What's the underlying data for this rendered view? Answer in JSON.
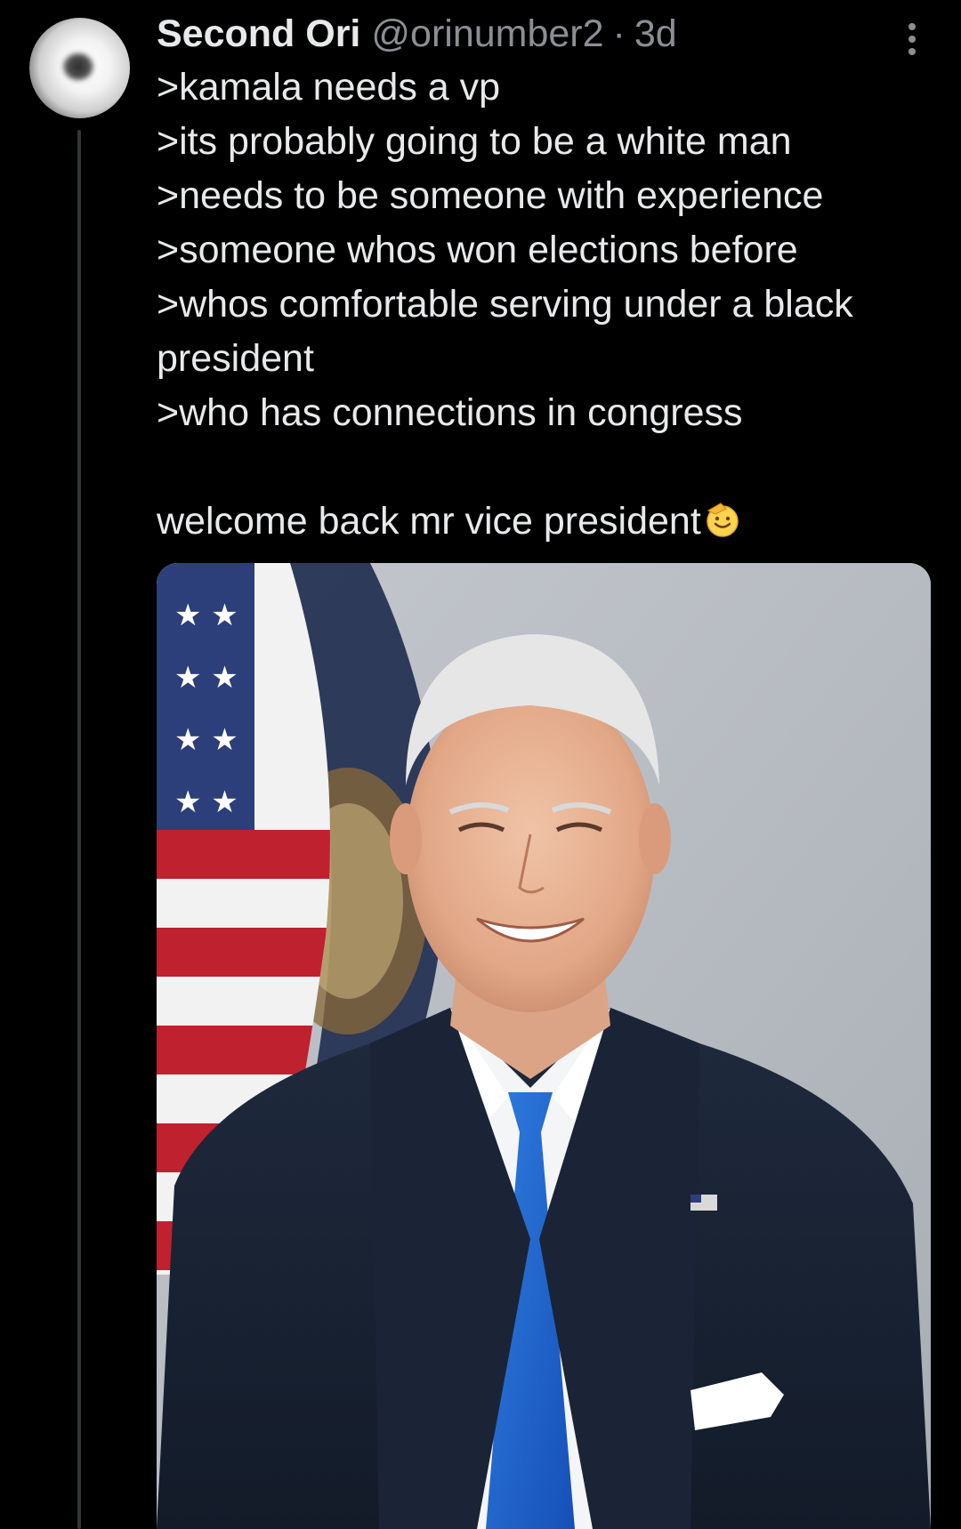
{
  "tweet": {
    "display_name": "Second Ori",
    "handle": "@orinumber2",
    "separator": "·",
    "time": "3d",
    "lines": [
      ">kamala needs a vp",
      ">its probably going to be a white man",
      ">needs to be someone with experience",
      ">someone whos won elections before",
      ">whos comfortable serving under a black president",
      ">who has connections in congress",
      "welcome back mr vice president"
    ],
    "emoji": "saluting-face",
    "media_description": "official portrait photo"
  },
  "colors": {
    "background": "#000000",
    "text": "#e7e9ea",
    "secondary": "#8b8f94",
    "thread_line": "#333639"
  }
}
